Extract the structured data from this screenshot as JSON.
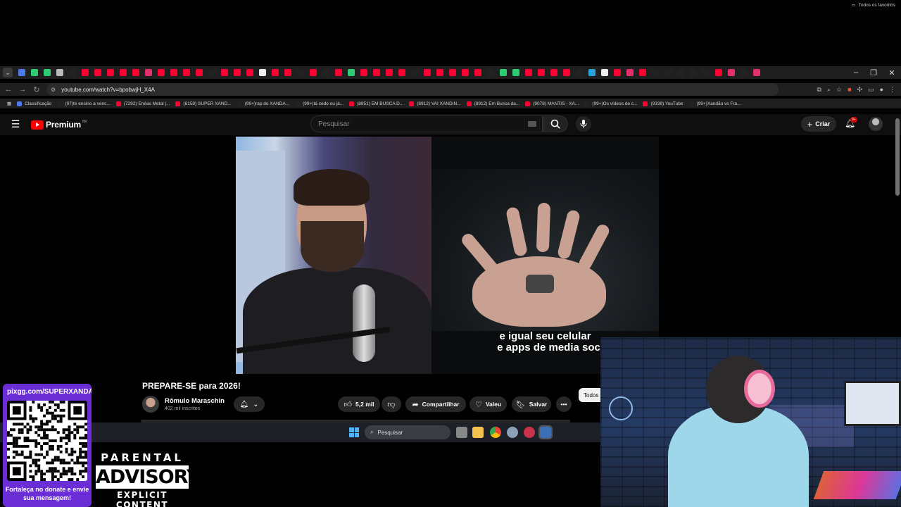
{
  "browser": {
    "url": "youtube.com/watch?v=bpobwjH_X4A",
    "bookmarks": [
      {
        "label": "Classificação",
        "color": "#4b7bec"
      },
      {
        "label": "(97)te ensino a venc...",
        "color": "#222222"
      },
      {
        "label": "(7292) Enéas Metal |...",
        "color": "#ff0033"
      },
      {
        "label": "(8159) SUPER XAND...",
        "color": "#ff0033"
      },
      {
        "label": "(99+)rap do XANDÃ...",
        "color": "#222222"
      },
      {
        "label": "(99+)tá cedo ou já...",
        "color": "#222222"
      },
      {
        "label": "(8851) EM BUSCA D...",
        "color": "#ff0033"
      },
      {
        "label": "(8912) VAI XANDIN...",
        "color": "#ff0033"
      },
      {
        "label": "(8912) Em Busca da...",
        "color": "#ff0033"
      },
      {
        "label": "(9078) MANTIS - XA...",
        "color": "#ff0033"
      },
      {
        "label": "(99+)Os vídeos de c...",
        "color": "#222222"
      },
      {
        "label": "(9338) YouTube",
        "color": "#ff0033"
      },
      {
        "label": "(99+)Xandão vs Fra...",
        "color": "#222222"
      }
    ],
    "all_bookmarks_label": "Todos os favoritos"
  },
  "youtube": {
    "logo_text": "Premium",
    "region": "BR",
    "search_placeholder": "Pesquisar",
    "create_label": "Criar",
    "notifications_badge": "9+"
  },
  "video": {
    "caption_line1": "e igual seu celular",
    "caption_line2": "e apps de media soc",
    "title": "PREPARE-SE para 2026!",
    "channel_name": "Rômulo Maraschin",
    "subscribers": "402 mil inscritos",
    "likes": "5,2 mil",
    "share_label": "Compartilhar",
    "thanks_label": "Valeu",
    "save_label": "Salvar",
    "more_label": "•••",
    "chip_label": "Todos"
  },
  "taskbar": {
    "search_label": "Pesquisar"
  },
  "overlay": {
    "qr_url": "pixgg.com/SUPERXANDÃO",
    "qr_message": "Fortaleça no donate e envie sua mensagem!",
    "advisory_line1": "PARENTAL",
    "advisory_line2": "ADVISORY",
    "advisory_line3": "EXPLICIT CONTENT"
  },
  "colors": {
    "youtube_red": "#ff0000",
    "qr_card": "#6a2dd6",
    "background": "#0f0f0f"
  }
}
